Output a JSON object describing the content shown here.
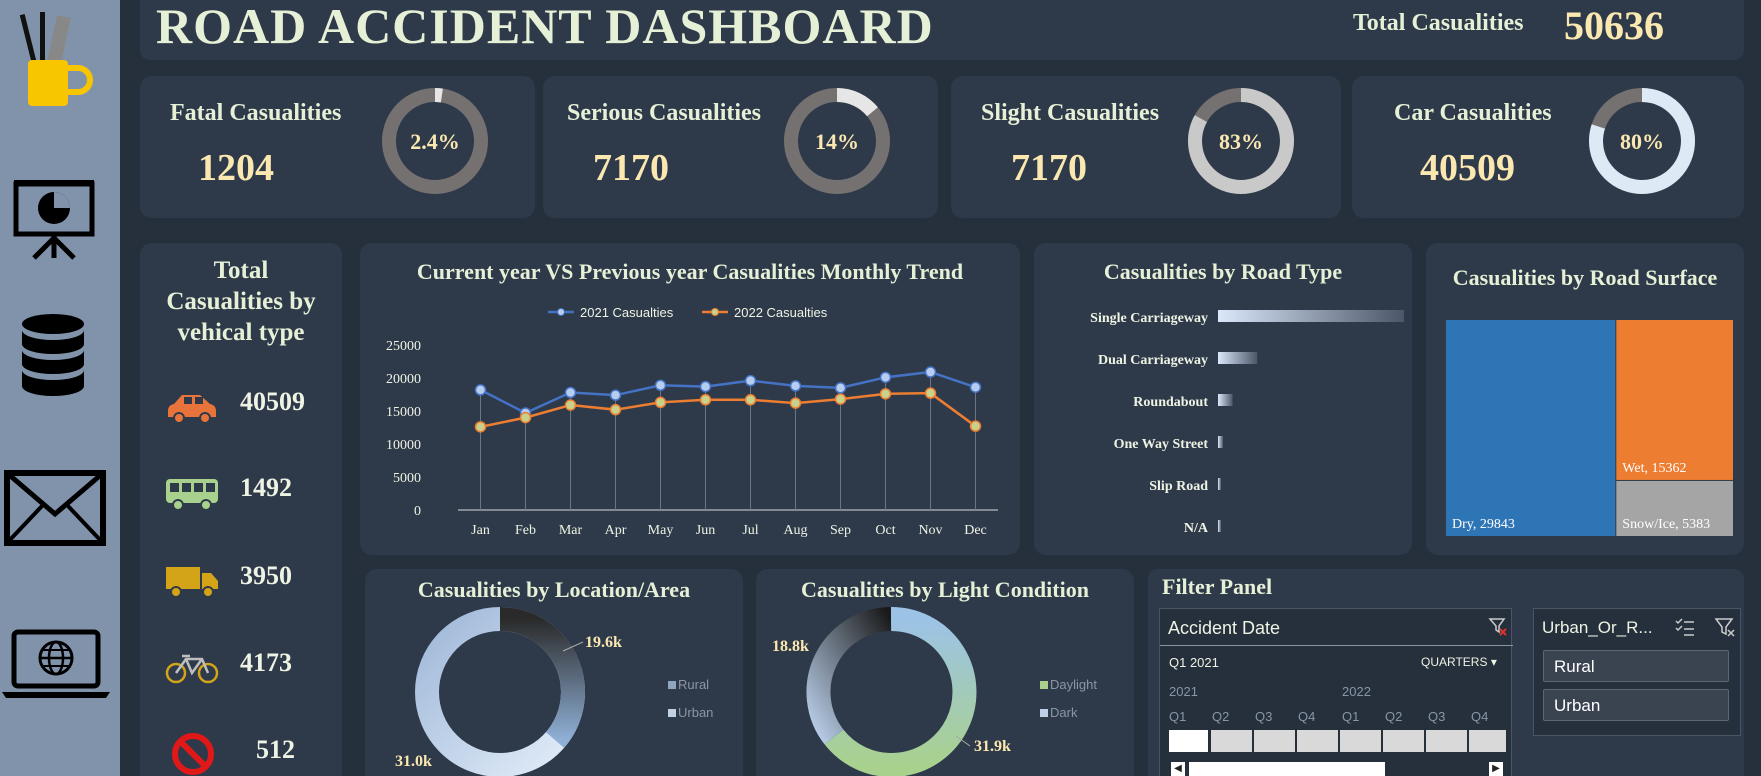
{
  "header": {
    "title": "ROAD ACCIDENT DASHBOARD",
    "total_label": "Total Casualities",
    "total_value": "50636"
  },
  "sidebar": {
    "icons": [
      "pencil-cup-icon",
      "presentation-chart-icon",
      "database-icon",
      "mail-icon",
      "laptop-globe-icon"
    ]
  },
  "kpis": [
    {
      "label": "Fatal Casualities",
      "value": "1204",
      "pct": "2.4%",
      "fraction": 0.024
    },
    {
      "label": "Serious Casualities",
      "value": "7170",
      "pct": "14%",
      "fraction": 0.14
    },
    {
      "label": "Slight Casualities",
      "value": "7170",
      "pct": "83%",
      "fraction": 0.83
    },
    {
      "label": "Car Casualities",
      "value": "40509",
      "pct": "80%",
      "fraction": 0.8
    }
  ],
  "vehicle": {
    "title_line1": "Total",
    "title_line2": "Casualities by",
    "title_line3": "vehical type",
    "items": [
      {
        "icon": "car-icon",
        "value": "40509"
      },
      {
        "icon": "bus-icon",
        "value": "1492"
      },
      {
        "icon": "truck-icon",
        "value": "3950"
      },
      {
        "icon": "bicycle-icon",
        "value": "4173"
      },
      {
        "icon": "prohibited-icon",
        "value": "512"
      }
    ]
  },
  "trend": {
    "title": "Current year VS Previous year Casualities Monthly Trend"
  },
  "road_type": {
    "title": "Casualities by Road Type"
  },
  "surface": {
    "title": "Casualities by Road Surface"
  },
  "location": {
    "title": "Casualities by Location/Area",
    "label_small": "19.6k",
    "label_large": "31.0k",
    "legend": [
      "Rural",
      "Urban"
    ],
    "values": [
      19.6,
      31.0
    ]
  },
  "light": {
    "title": "Casualities by Light Condition",
    "label_small": "18.8k",
    "label_large": "31.9k",
    "legend": [
      "Daylight",
      "Dark"
    ],
    "values": [
      31.9,
      18.8
    ]
  },
  "filter": {
    "title": "Filter Panel",
    "date_slicer": {
      "title": "Accident Date",
      "selected": "Q1 2021",
      "level": "QUARTERS",
      "years": [
        "2021",
        "2022"
      ],
      "quarters": [
        "Q1",
        "Q2",
        "Q3",
        "Q4",
        "Q1",
        "Q2",
        "Q3",
        "Q4"
      ]
    },
    "area_slicer": {
      "title": "Urban_Or_R...",
      "options": [
        "Rural",
        "Urban"
      ]
    }
  },
  "chart_data": [
    {
      "type": "line",
      "title": "Current year VS Previous year Casualities Monthly Trend",
      "categories": [
        "Jan",
        "Feb",
        "Mar",
        "Apr",
        "May",
        "Jun",
        "Jul",
        "Aug",
        "Sep",
        "Oct",
        "Nov",
        "Dec"
      ],
      "yticks": [
        "25000",
        "20000",
        "15000",
        "10000",
        "5000",
        "0"
      ],
      "ylim": [
        0,
        25000
      ],
      "series": [
        {
          "name": "2021 Casualties",
          "color": "#4472c4",
          "values": [
            18200,
            14700,
            17800,
            17400,
            18900,
            18700,
            19600,
            18800,
            18500,
            20100,
            20900,
            18600
          ]
        },
        {
          "name": "2022 Casualties",
          "color": "#ed7d31",
          "values": [
            12600,
            14000,
            15900,
            15200,
            16300,
            16700,
            16700,
            16200,
            16800,
            17600,
            17700,
            12700
          ]
        }
      ]
    },
    {
      "type": "bar",
      "title": "Casualities by Road Type",
      "categories": [
        "Single Carriageway",
        "Dual Carriageway",
        "Roundabout",
        "One Way Street",
        "Slip Road",
        "N/A"
      ],
      "values": [
        37000,
        7800,
        2900,
        1000,
        550,
        250
      ]
    },
    {
      "type": "treemap",
      "title": "Casualities by Road Surface",
      "items": [
        {
          "label": "Dry, 29843",
          "value": 29843,
          "color": "#2e75b6"
        },
        {
          "label": "Wet, 15362",
          "value": 15362,
          "color": "#ed7d31"
        },
        {
          "label": "Snow/Ice, 5383",
          "value": 5383,
          "color": "#a5a5a5"
        }
      ]
    }
  ]
}
